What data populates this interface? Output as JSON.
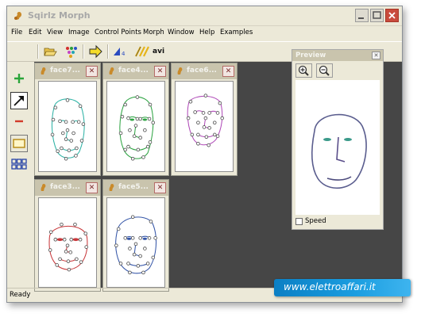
{
  "app": {
    "title": "Sqirlz Morph"
  },
  "menu": [
    "File",
    "Edit",
    "View",
    "Image",
    "Control Points",
    "Morph",
    "Window",
    "Help",
    "Examples"
  ],
  "toolbar": {
    "avi_label": "avi"
  },
  "child_windows": [
    {
      "title": "face7...",
      "face_color": "#2fb3a6"
    },
    {
      "title": "face4...",
      "face_color": "#2ea443"
    },
    {
      "title": "face6...",
      "face_color": "#b04bb8"
    },
    {
      "title": "face3...",
      "face_color": "#c8373a"
    },
    {
      "title": "face5...",
      "face_color": "#3556a8"
    }
  ],
  "preview": {
    "title": "Preview",
    "speed_label": "Speed",
    "speed_checked": false
  },
  "status": {
    "text": "Ready",
    "indicator": "ok"
  },
  "watermark": {
    "text": "www.elettroaffari.it"
  },
  "icons": {
    "app": "squirrel-icon",
    "open": "folder-open-icon",
    "colors": "color-dots-icon",
    "next": "arrow-right-icon",
    "zoom_in": "zoom-in-icon",
    "zoom_out": "zoom-out-icon"
  }
}
